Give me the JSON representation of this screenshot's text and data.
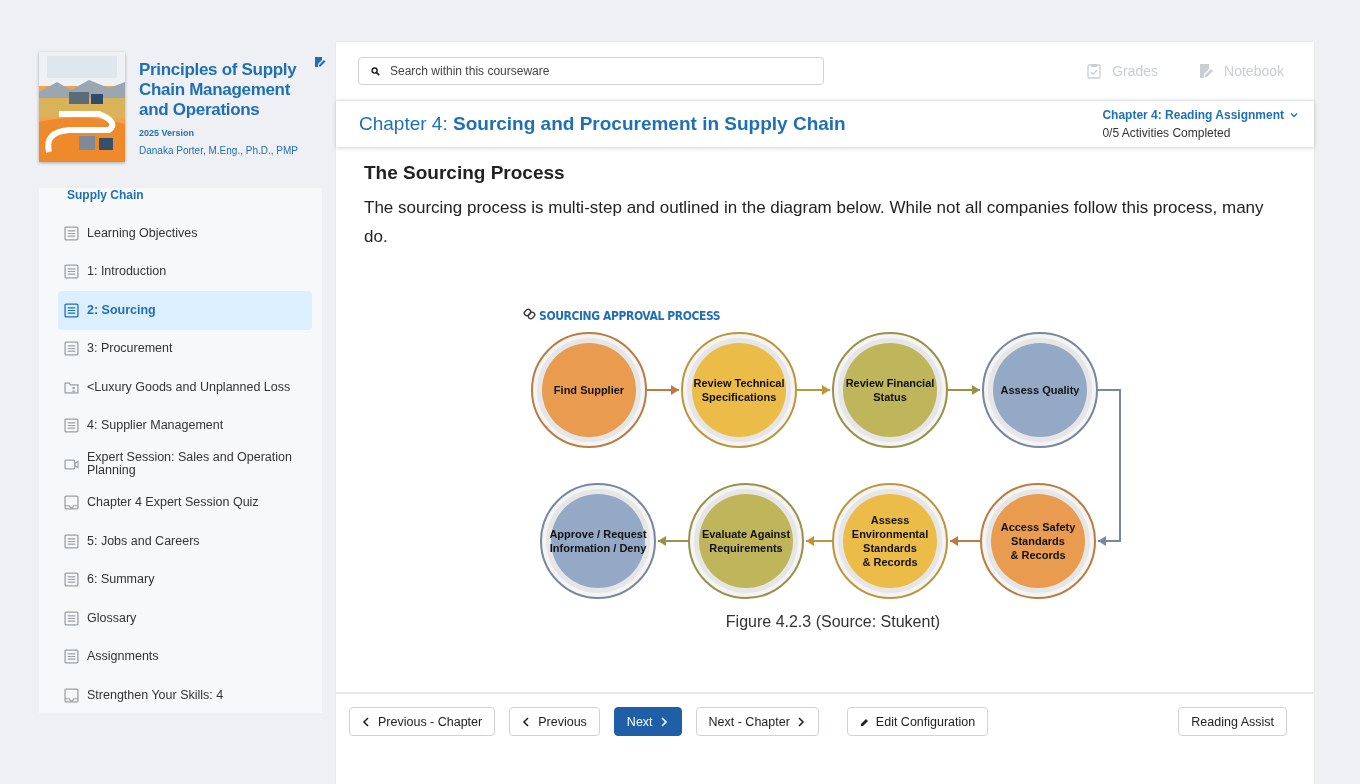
{
  "book": {
    "title": "Principles of Supply Chain Management and Operations",
    "version": "2025 Version",
    "author": "Danaka Porter, M.Eng., Ph.D., PMP"
  },
  "sidebar": {
    "heading": "Supply Chain",
    "items": [
      {
        "label": "Learning Objectives",
        "kind": "page",
        "selected": false
      },
      {
        "label": "1: Introduction",
        "kind": "page",
        "selected": false
      },
      {
        "label": "2: Sourcing",
        "kind": "page",
        "selected": true
      },
      {
        "label": "3: Procurement",
        "kind": "page",
        "selected": false
      },
      {
        "label": "<Luxury Goods and Unplanned Loss",
        "kind": "folder",
        "selected": false
      },
      {
        "label": "4: Supplier Management",
        "kind": "page",
        "selected": false
      },
      {
        "label": "Expert Session: Sales and Operation Planning",
        "kind": "video",
        "selected": false
      },
      {
        "label": "Chapter 4 Expert Session Quiz",
        "kind": "quiz",
        "selected": false
      },
      {
        "label": "5: Jobs and Careers",
        "kind": "page",
        "selected": false
      },
      {
        "label": "6: Summary",
        "kind": "page",
        "selected": false
      },
      {
        "label": "Glossary",
        "kind": "page",
        "selected": false
      },
      {
        "label": "Assignments",
        "kind": "page",
        "selected": false
      },
      {
        "label": "Strengthen Your Skills: 4",
        "kind": "quiz",
        "selected": false
      }
    ]
  },
  "search": {
    "placeholder": "Search within this courseware"
  },
  "top_links": [
    {
      "label": "Grades",
      "kind": "grades",
      "disabled": true
    },
    {
      "label": "Notebook",
      "kind": "notebook",
      "disabled": true
    }
  ],
  "chapter": {
    "title": "Chapter 4: **Sourcing and Procurement in Supply Chain**",
    "assignment": "Chapter 4: Reading Assignment",
    "progress": "0/5 Activities Completed"
  },
  "content": {
    "heading": "The Sourcing Process",
    "paragraph": "The sourcing process is multi-step and outlined in the diagram below. While not all companies follow this process, many do.",
    "diagram": {
      "title": "SOURCING APPROVAL PROCESS",
      "rows": [
        {
          "steps": [
            {
              "label": "Find Supplier",
              "color": "#e99b4f"
            },
            {
              "label": "Review Technical\nSpecifications",
              "color": "#ecbc48"
            },
            {
              "label": "Review Financial\nStatus",
              "color": "#bfb55a"
            },
            {
              "label": "Assess Quality",
              "color": "#94a9c6"
            }
          ]
        },
        {
          "steps": [
            {
              "label": "Approve / Request\nInformation / Deny",
              "color": "#94a9c6"
            },
            {
              "label": "Evaluate Against\nRequirements",
              "color": "#bfb55a"
            },
            {
              "label": "Assess\nEnvironmental\nStandards\n& Records",
              "color": "#ecbc48"
            },
            {
              "label": "Access Safety\nStandards\n& Records",
              "color": "#e99b4f"
            }
          ]
        }
      ]
    },
    "caption": "Figure 4.2.3 (Source: Stukent)"
  },
  "footer": {
    "buttons": [
      {
        "label": "Previous - Chapter",
        "kind": "back",
        "primary": false
      },
      {
        "label": "Previous",
        "kind": "back",
        "primary": false
      },
      {
        "label": "Next",
        "kind": "forward",
        "primary": true
      },
      {
        "label": "Next - Chapter",
        "kind": "forward",
        "primary": false
      },
      {
        "label": "Edit Configuration",
        "kind": "edit",
        "primary": false
      }
    ],
    "right_buttons": [
      {
        "label": "Reading Assist",
        "primary": false
      }
    ]
  }
}
